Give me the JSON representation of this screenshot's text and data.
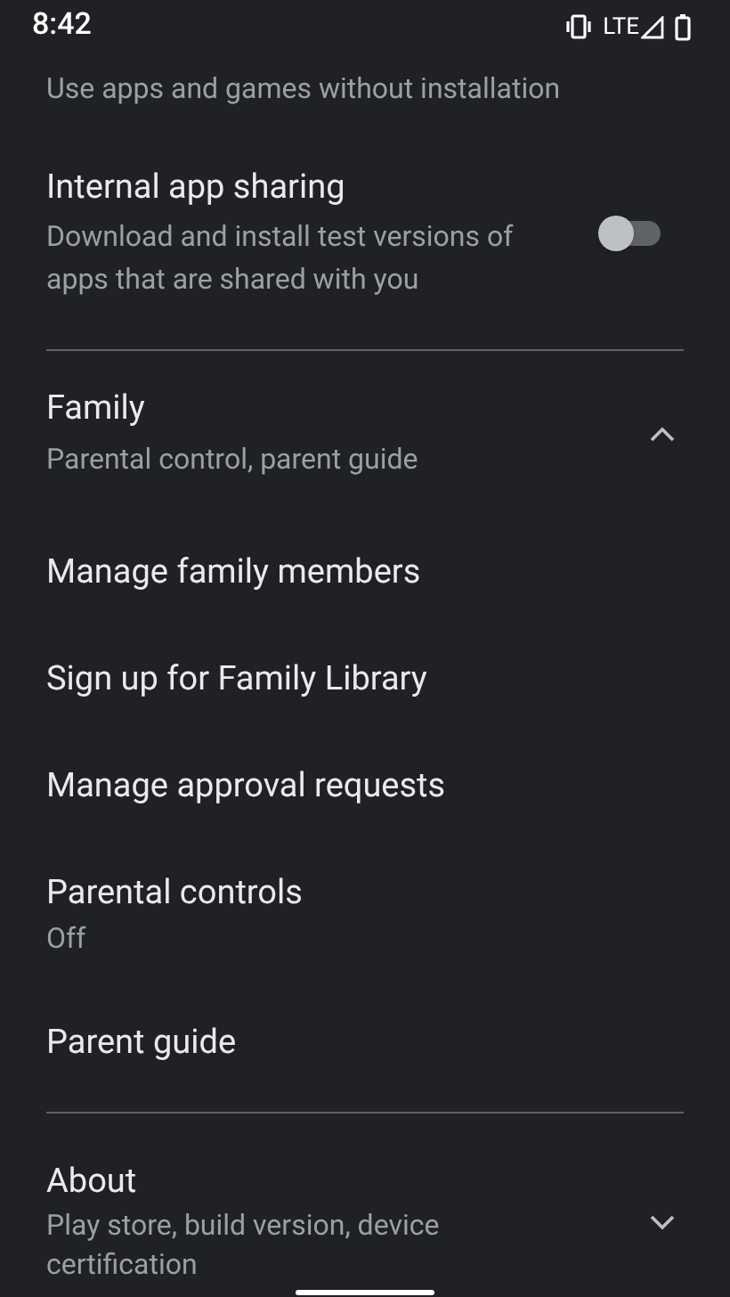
{
  "status_bar": {
    "time": "8:42",
    "network": "LTE"
  },
  "items": [
    {
      "kind": "partial",
      "subtitle": "Use apps and games without installation"
    },
    {
      "kind": "toggle",
      "title": "Internal app sharing",
      "subtitle": "Download and install test versions of apps that are shared with you",
      "on": false
    },
    {
      "kind": "divider"
    },
    {
      "kind": "group",
      "title": "Family",
      "subtitle": "Parental control, parent guide",
      "expanded": true,
      "children": [
        {
          "title": "Manage family members"
        },
        {
          "title": "Sign up for Family Library"
        },
        {
          "title": "Manage approval requests"
        },
        {
          "title": "Parental controls",
          "subtitle": "Off"
        },
        {
          "title": "Parent guide"
        }
      ]
    },
    {
      "kind": "divider"
    },
    {
      "kind": "group",
      "title": "About",
      "subtitle": "Play store, build version, device certification",
      "expanded": false
    }
  ]
}
